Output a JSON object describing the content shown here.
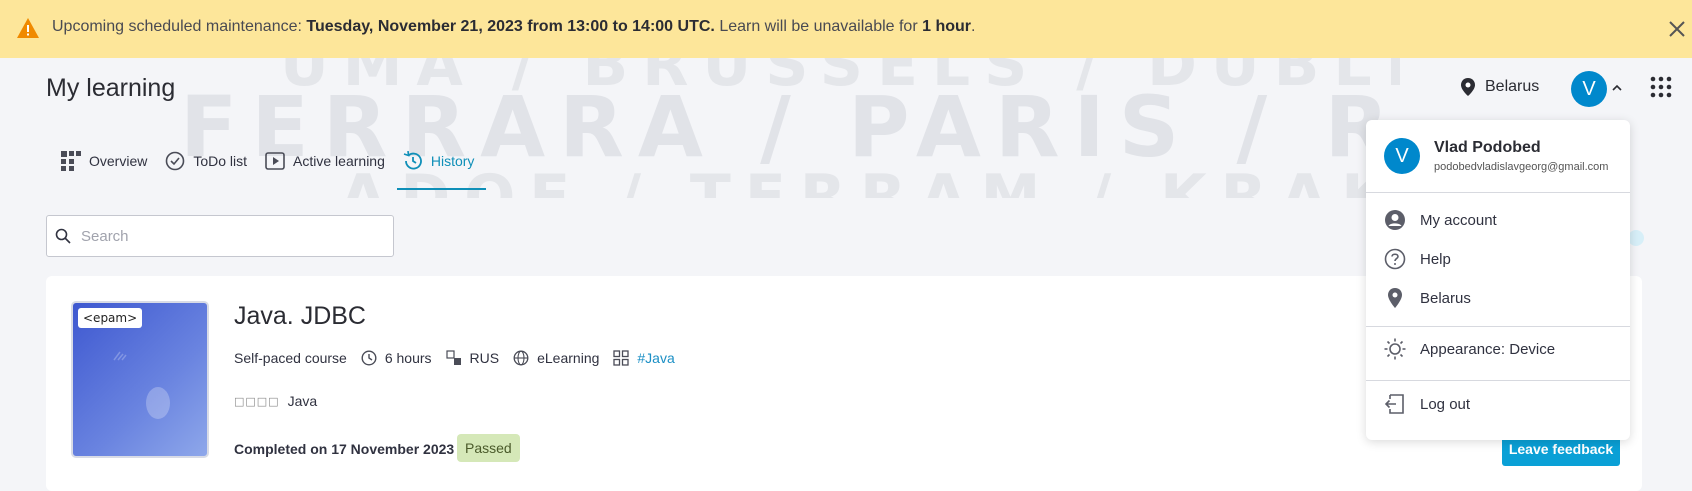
{
  "banner": {
    "prefix": "Upcoming scheduled maintenance:",
    "date": "Tuesday, November 21, 2023 from 13:00 to 14:00 UTC.",
    "middle": "Learn will be unavailable for",
    "duration": "1 hour",
    "suffix": "."
  },
  "watermark": {
    "row1": "UMA / BRUSSELS / DUBLIN / POTSDAM",
    "row2": "FERRARA / PARIS / ROME / OSLO / FERR",
    "row3": "ADOE / TERRAM / KRAKOW / TO"
  },
  "header": {
    "title": "My learning",
    "location": "Belarus",
    "avatar_initial": "V"
  },
  "tabs": [
    {
      "label": "Overview"
    },
    {
      "label": "ToDo list"
    },
    {
      "label": "Active learning"
    },
    {
      "label": "History"
    }
  ],
  "search": {
    "placeholder": "Search"
  },
  "course": {
    "logo": "<epam>",
    "title": "Java. JDBC",
    "type": "Self-paced course",
    "duration": "6 hours",
    "language": "RUS",
    "format": "eLearning",
    "tag": "#Java",
    "skill_boxes": "□□□□",
    "skill": "Java",
    "completed": "Completed on 17 November 2023",
    "status": "Passed",
    "feedback_label": "Leave feedback"
  },
  "user_menu": {
    "avatar_initial": "V",
    "name": "Vlad Podobed",
    "email": "podobedvladislavgeorg@gmail.com",
    "items": [
      {
        "label": "My account"
      },
      {
        "label": "Help"
      },
      {
        "label": "Belarus"
      },
      {
        "label": "Appearance: Device"
      },
      {
        "label": "Log out"
      }
    ]
  },
  "colors": {
    "banner": "#fde69a",
    "accent": "#0f8fb8",
    "button": "#0aa0d6",
    "avatar": "#0088cc",
    "passed_badge": "#d5e8b8"
  }
}
